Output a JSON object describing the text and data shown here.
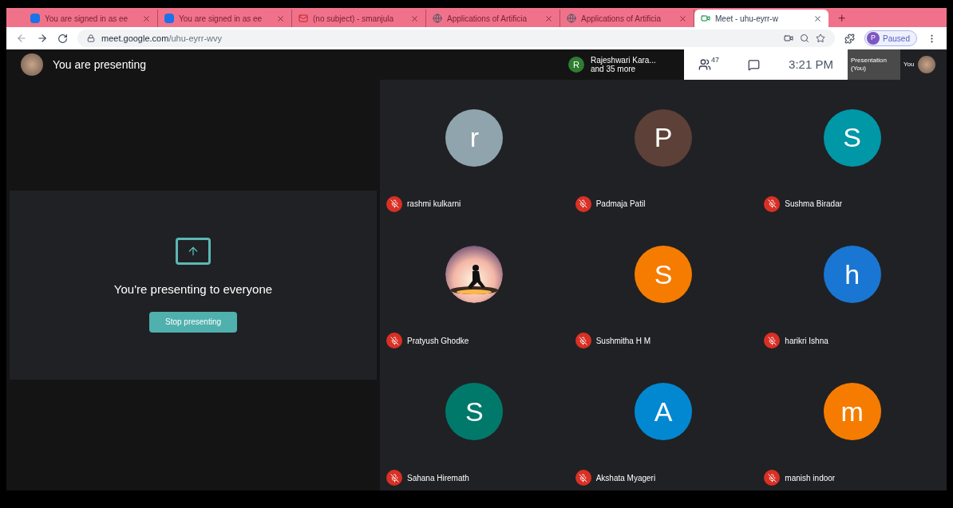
{
  "browser": {
    "tabs": [
      {
        "title": "You are signed in as ee",
        "kind": "s",
        "selected": false
      },
      {
        "title": "You are signed in as ee",
        "kind": "s",
        "selected": false
      },
      {
        "title": "(no subject) - smanjula",
        "kind": "mail",
        "selected": false
      },
      {
        "title": "Applications of Artificia",
        "kind": "globe",
        "selected": false
      },
      {
        "title": "Applications of Artificia",
        "kind": "globe",
        "selected": false
      },
      {
        "title": "Meet - uhu-eyrr-w",
        "kind": "meet",
        "selected": true
      }
    ],
    "new_tab": "+",
    "url_domain": "meet.google.com",
    "url_path": "/uhu-eyrr-wvy",
    "profile": {
      "initial": "P",
      "label": "Paused"
    }
  },
  "meet": {
    "presenting_label": "You are presenting",
    "speaker": {
      "initial": "R",
      "name": "Rajeshwari Kara...",
      "more": "and 35 more"
    },
    "people_count": "47",
    "time": "3:21 PM",
    "self_tiles": [
      {
        "label": "Presentation (You)"
      },
      {
        "label": "You"
      }
    ],
    "presenting_card": {
      "message": "You're presenting to everyone",
      "button": "Stop presenting"
    },
    "participant_avatars": [
      {
        "kind": "letter",
        "initial": "r",
        "color": "#90a4ae"
      },
      {
        "kind": "letter",
        "initial": "P",
        "color": "#5d4037"
      },
      {
        "kind": "letter",
        "initial": "S",
        "color": "#0097a7"
      },
      {
        "kind": "picture"
      },
      {
        "kind": "letter",
        "initial": "S",
        "color": "#f57c00"
      },
      {
        "kind": "letter",
        "initial": "h",
        "color": "#1976d2"
      },
      {
        "kind": "letter",
        "initial": "S",
        "color": "#00796b"
      },
      {
        "kind": "letter",
        "initial": "A",
        "color": "#0288d1"
      },
      {
        "kind": "letter",
        "initial": "m",
        "color": "#f57c00"
      }
    ],
    "participant_names": [
      {
        "name": "rashmi kulkarni",
        "muted": true
      },
      {
        "name": "Padmaja Patil",
        "muted": true
      },
      {
        "name": "Sushma Biradar",
        "muted": true
      },
      {
        "name": "Pratyush Ghodke",
        "muted": true
      },
      {
        "name": "Sushmitha H M",
        "muted": true
      },
      {
        "name": "harikri Ishna",
        "muted": true
      },
      {
        "name": "Sahana Hiremath",
        "muted": true
      },
      {
        "name": "Akshata Myageri",
        "muted": true
      },
      {
        "name": "manish indoor",
        "muted": true
      }
    ]
  }
}
